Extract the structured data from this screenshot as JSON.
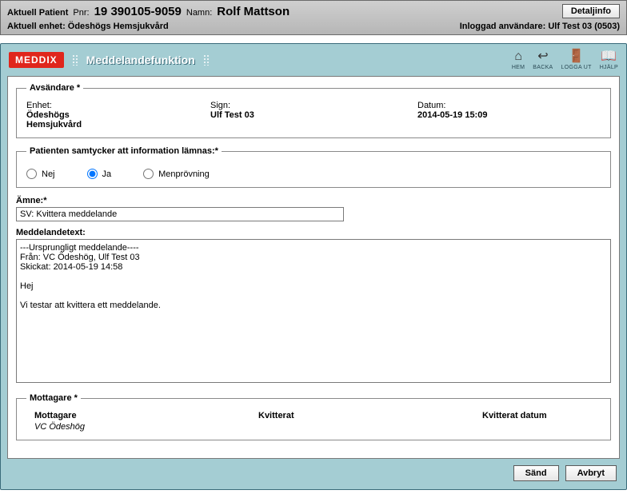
{
  "header": {
    "patient_label": "Aktuell Patient",
    "pnr_label": "Pnr:",
    "pnr_value": "19 390105-9059",
    "name_label": "Namn:",
    "name_value": "Rolf Mattson",
    "detail_button": "Detaljinfo",
    "unit_line": "Aktuell enhet: Ödeshögs Hemsjukvård",
    "user_line": "Inloggad användare: Ulf Test 03 (0503)"
  },
  "app": {
    "logo": "MEDDIX",
    "title": "Meddelandefunktion",
    "nav": {
      "home": "HEM",
      "back": "BACKA",
      "logout": "LOGGA UT",
      "help": "HJÄLP"
    }
  },
  "sender": {
    "legend": "Avsändare *",
    "unit_label": "Enhet:",
    "unit_value": "Ödeshögs Hemsjukvård",
    "sign_label": "Sign:",
    "sign_value": "Ulf Test 03",
    "date_label": "Datum:",
    "date_value": "2014-05-19 15:09"
  },
  "consent": {
    "legend": "Patienten samtycker att information lämnas:*",
    "options": {
      "no": "Nej",
      "yes": "Ja",
      "men": "Menprövning"
    },
    "selected": "yes"
  },
  "subject": {
    "label": "Ämne:*",
    "value": "SV: Kvittera meddelande"
  },
  "message": {
    "label": "Meddelandetext:",
    "value": "---Ursprungligt meddelande----\nFrån: VC Ödeshög, Ulf Test 03\nSkickat: 2014-05-19 14:58\n\nHej\n\nVi testar att kvittera ett meddelande."
  },
  "recipients": {
    "legend": "Mottagare *",
    "col1": "Mottagare",
    "col2": "Kvitterat",
    "col3": "Kvitterat datum",
    "rows": [
      {
        "name": "VC Ödeshög"
      }
    ]
  },
  "actions": {
    "send": "Sänd",
    "cancel": "Avbryt"
  }
}
